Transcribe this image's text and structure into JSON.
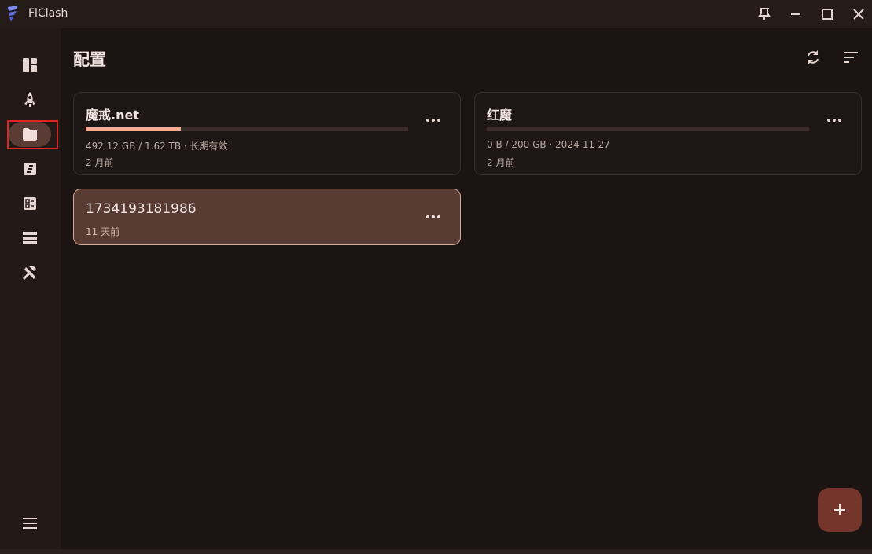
{
  "window": {
    "title": "FlClash"
  },
  "page": {
    "title": "配置"
  },
  "profiles": [
    {
      "name": "魔戒.net",
      "usage": "492.12 GB / 1.62 TB · 长期有效",
      "updated": "2 月前",
      "progress": 0.296,
      "selected": false
    },
    {
      "name": "红魔",
      "usage": "0 B / 200 GB · 2024-11-27",
      "updated": "2 月前",
      "progress": 0,
      "selected": false
    },
    {
      "name": "1734193181986",
      "updated": "11 天前",
      "selected": true
    }
  ],
  "colors": {
    "accent": "#f4ab92",
    "selected_card": "#583b33",
    "fab": "#74352a",
    "highlight": "#e02424"
  },
  "icons": [
    "dashboard-icon",
    "rocket-icon",
    "folder-icon",
    "log-icon",
    "resources-icon",
    "connections-icon",
    "tools-icon",
    "menu-icon",
    "refresh-icon",
    "sort-icon",
    "more-icon",
    "add-icon",
    "pin-icon",
    "minimize-icon",
    "maximize-icon",
    "close-icon"
  ]
}
